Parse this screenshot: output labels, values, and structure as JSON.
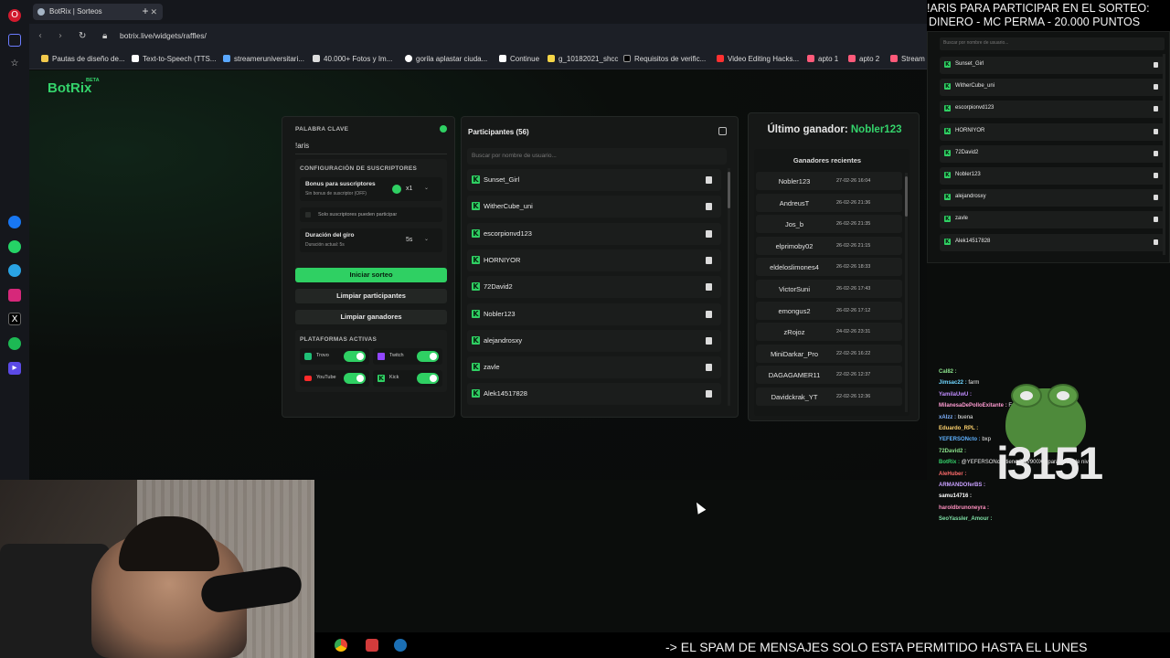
{
  "browser": {
    "tab_title": "BotRix | Sorteos",
    "new_tab_glyph": "+",
    "url": "botrix.live/widgets/raffles/",
    "bookmarks": [
      "Pautas de diseño de...",
      "Text-to-Speech (TTS...",
      "streameruniversitari...",
      "40.000+ Fotos y Im...",
      "gorila aplastar ciuda...",
      "Continue",
      "g_10182021_shcc",
      "Requisitos de verific...",
      "Video Editing Hacks...",
      "apto 1",
      "apto 2",
      "Stream"
    ]
  },
  "brand": {
    "name": "BotRix",
    "badge": "BETA"
  },
  "config": {
    "keyword_label": "PALABRA CLAVE",
    "keyword_value": "!aris",
    "subs_section_label": "CONFIGURACIÓN DE SUSCRIPTORES",
    "bonus_title": "Bonus para suscriptores",
    "bonus_sub": "Sin bonus de suscriptor (OFF)",
    "bonus_value": "x1",
    "subs_only": "Solo suscriptores pueden participar",
    "spin_title": "Duración del giro",
    "spin_sub": "Duración actual: 5s",
    "spin_value": "5s",
    "start_button": "Iniciar sorteo",
    "clear_participants": "Limpiar participantes",
    "clear_winners": "Limpiar ganadores",
    "platforms_label": "PLATAFORMAS ACTIVAS",
    "platforms": [
      "Trovo",
      "Twitch",
      "YouTube",
      "Kick"
    ]
  },
  "participants": {
    "title": "Participantes (56)",
    "search_placeholder": "Buscar por nombre de usuario...",
    "items": [
      "Sunset_Girl",
      "WitherCube_uni",
      "escorpionvd123",
      "HORNIYOR",
      "72David2",
      "Nobler123",
      "alejandrosxy",
      "zavle",
      "Alek14517828"
    ]
  },
  "winners": {
    "last_label": "Último ganador:",
    "last_name": "Nobler123",
    "recent_title": "Ganadores recientes",
    "items": [
      {
        "name": "Nobler123",
        "date": "27-02-26 16:04"
      },
      {
        "name": "AndreusT",
        "date": "26-02-26 21:36"
      },
      {
        "name": "Jos_b",
        "date": "26-02-26 21:35"
      },
      {
        "name": "elprimoby02",
        "date": "26-02-26 21:15"
      },
      {
        "name": "eldeloslimones4",
        "date": "26-02-26 18:33"
      },
      {
        "name": "VictorSuni",
        "date": "26-02-26 17:43"
      },
      {
        "name": "emongus2",
        "date": "26-02-26 17:12"
      },
      {
        "name": "zRojoz",
        "date": "24-02-26 23:31"
      },
      {
        "name": "MiniDarkar_Pro",
        "date": "22-02-26 16:22"
      },
      {
        "name": "DAGAGAMER11",
        "date": "22-02-26 12:37"
      },
      {
        "name": "Davidckrak_YT",
        "date": "22-02-26 12:36"
      }
    ]
  },
  "overlay": {
    "banner_line1": "!ARIS PARA PARTICIPAR EN EL SORTEO:",
    "banner_line2": "DINERO - MC PERMA - 20.000 PUNTOS",
    "mini_search_placeholder": "Buscar por nombre de usuario...",
    "mini_items": [
      "Sunset_Girl",
      "WitherCube_uni",
      "escorpionvd123",
      "HORNIYOR",
      "72David2",
      "Nobler123",
      "alejandrosxy",
      "zavle",
      "Alek14517828"
    ],
    "chat": [
      {
        "user": "Cal82 :",
        "msg": "",
        "color": "#8be28b"
      },
      {
        "user": "Jimsac22 :",
        "msg": "farm",
        "color": "#6fd6ff"
      },
      {
        "user": "YamilaUwU :",
        "msg": "",
        "color": "#c08cff"
      },
      {
        "user": "MilanesaDePolloExitante :",
        "msg": "Farm",
        "color": "#ff9bd2"
      },
      {
        "user": "xAlzz :",
        "msg": "buena",
        "color": "#7fb2ff"
      },
      {
        "user": "Eduardo_RPL :",
        "msg": "",
        "color": "#ffd36e"
      },
      {
        "user": "YEFERSONcto :",
        "msg": "bxp",
        "color": "#5fb2ff"
      },
      {
        "user": "72David2 :",
        "msg": "",
        "color": "#8be28b"
      },
      {
        "user": "BotRix :",
        "msg": "@YEFERSONcto tiene 530/900XP para subir de nivel.",
        "color": "#34d36b"
      },
      {
        "user": "AleHuber :",
        "msg": "",
        "color": "#ff6b6b"
      },
      {
        "user": "ARMANDOferBS :",
        "msg": "",
        "color": "#c9a0ff"
      },
      {
        "user": "samu14716 :",
        "msg": "",
        "color": "#ffffff"
      },
      {
        "user": "haroldbrunoneyra :",
        "msg": "",
        "color": "#ff8fbf"
      },
      {
        "user": "SeoYassler_Amour :",
        "msg": "",
        "color": "#7fe0a6"
      }
    ],
    "counter": "i3151",
    "ticker": "-> EL SPAM DE MENSAJES SOLO ESTA PERMITIDO HASTA EL LUNES"
  }
}
